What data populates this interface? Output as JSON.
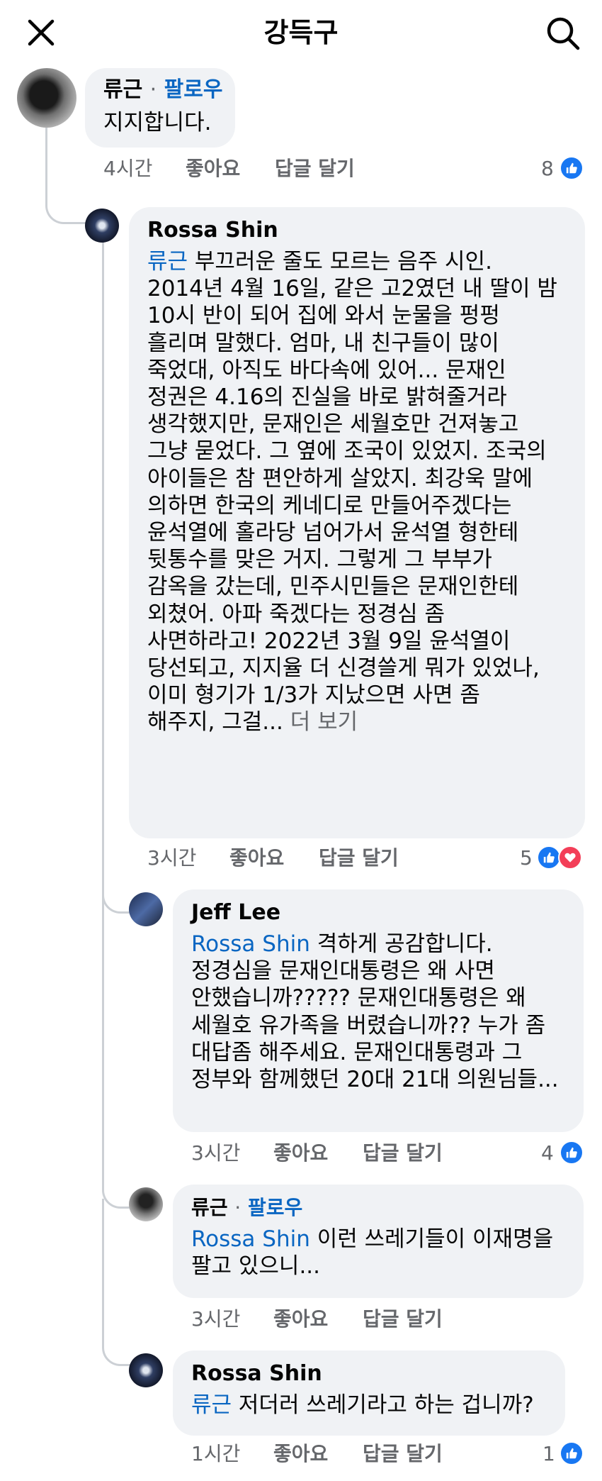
{
  "header": {
    "title": "강득구",
    "close_icon": "close-icon",
    "search_icon": "search-icon"
  },
  "comments": [
    {
      "author": "류근",
      "separator": "·",
      "follow_label": "팔로우",
      "text_lines": [
        "지지합니다."
      ],
      "time": "4시간",
      "like_label": "좋아요",
      "reply_label": "답글 달기",
      "reaction_count": "8",
      "reactions": [
        "like"
      ]
    },
    {
      "author": "Rossa Shin",
      "mention": "류근",
      "first_line_rest": " 부끄러운 줄도 모르는 음주 시인.",
      "text_lines": [
        "2014년 4월 16일, 같은 고2였던 내 딸이 밤",
        "10시 반이 되어 집에 와서 눈물을 펑펑",
        "흘리며 말했다. 엄마, 내 친구들이 많이",
        "죽었대, 아직도 바다속에 있어... 문재인",
        "정권은 4.16의 진실을 바로 밝혀줄거라",
        "생각했지만, 문재인은 세월호만 건져놓고",
        "그냥 묻었다. 그 옆에 조국이 있었지. 조국의",
        "아이들은 참 편안하게 살았지. 최강욱 말에",
        "의하면 한국의 케네디로 만들어주겠다는",
        "윤석열에 홀라당 넘어가서 윤석열 형한테",
        "뒷통수를 맞은 거지. 그렇게 그 부부가",
        "감옥을 갔는데, 민주시민들은 문재인한테",
        "외쳤어. 아파 죽겠다는 정경심 좀",
        "사면하라고! 2022년 3월 9일 윤석열이",
        "당선되고, 지지율 더 신경쓸게 뭐가 있었나,",
        "이미 형기가 1/3가 지났으면 사면 좀"
      ],
      "last_line": "해주지, 그걸...",
      "see_more": "더 보기",
      "time": "3시간",
      "like_label": "좋아요",
      "reply_label": "답글 달기",
      "reaction_count": "5",
      "reactions": [
        "like",
        "love"
      ]
    },
    {
      "author": "Jeff Lee",
      "mention": "Rossa Shin",
      "first_line_rest": " 격하게 공감합니다.",
      "text_lines": [
        "정경심을 문재인대통령은 왜 사면",
        "안했습니까????? 문재인대통령은 왜",
        "세월호 유가족을 버렸습니까?? 누가 좀",
        "대답좀 해주세요. 문재인대통령과 그",
        "정부와 함께했던 20대 21대 의원님들..."
      ],
      "time": "3시간",
      "like_label": "좋아요",
      "reply_label": "답글 달기",
      "reaction_count": "4",
      "reactions": [
        "like"
      ]
    },
    {
      "author": "류근",
      "separator": "·",
      "follow_label": "팔로우",
      "mention": "Rossa Shin",
      "first_line_rest": " 이런 쓰레기들이 이재명을",
      "text_lines": [
        "팔고 있으니..."
      ],
      "time": "3시간",
      "like_label": "좋아요",
      "reply_label": "답글 달기"
    },
    {
      "author": "Rossa Shin",
      "mention": "류근",
      "first_line_rest": " 저더러 쓰레기라고 하는 겁니까?",
      "time": "1시간",
      "like_label": "좋아요",
      "reply_label": "답글 달기",
      "reaction_count": "1",
      "reactions": [
        "like"
      ]
    }
  ]
}
